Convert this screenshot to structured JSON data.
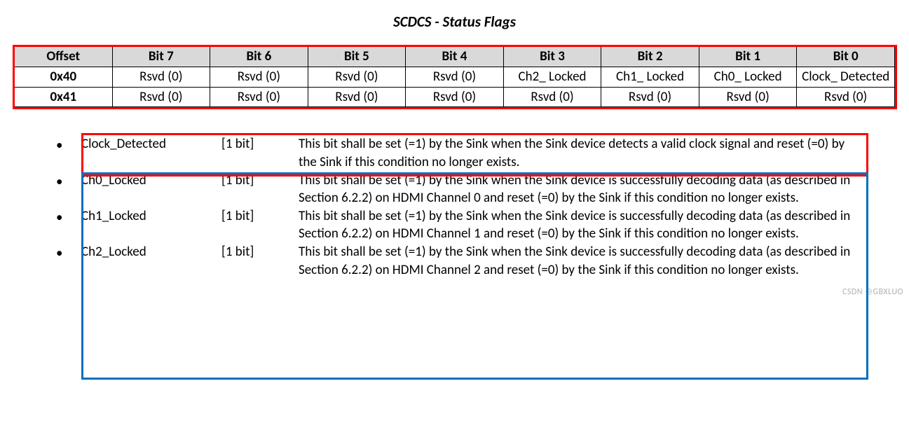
{
  "title": "SCDCS - Status Flags",
  "table": {
    "headers": [
      "Offset",
      "Bit 7",
      "Bit 6",
      "Bit 5",
      "Bit 4",
      "Bit 3",
      "Bit 2",
      "Bit 1",
      "Bit 0"
    ],
    "rows": [
      {
        "offset": "0x40",
        "bits": [
          "Rsvd (0)",
          "Rsvd (0)",
          "Rsvd (0)",
          "Rsvd (0)",
          "Ch2_\nLocked",
          "Ch1_\nLocked",
          "Ch0_\nLocked",
          "Clock_\nDetected"
        ]
      },
      {
        "offset": "0x41",
        "bits": [
          "Rsvd (0)",
          "Rsvd (0)",
          "Rsvd (0)",
          "Rsvd (0)",
          "Rsvd (0)",
          "Rsvd (0)",
          "Rsvd (0)",
          "Rsvd (0)"
        ]
      }
    ]
  },
  "fields": [
    {
      "name": "Clock_Detected",
      "size": "[1 bit]",
      "desc": "This bit shall be set (=1) by the Sink when the Sink device detects a valid clock signal and reset (=0) by the Sink if this condition no longer exists."
    },
    {
      "name": "Ch0_Locked",
      "size": "[1 bit]",
      "desc": "This bit shall be set (=1) by the Sink when the Sink device is successfully decoding data (as described in Section 6.2.2) on HDMI Channel 0 and reset (=0) by the Sink if this condition no longer exists."
    },
    {
      "name": "Ch1_Locked",
      "size": "[1 bit]",
      "desc": "This bit shall be set (=1) by the Sink when the Sink device is successfully decoding data (as described in Section 6.2.2) on HDMI Channel 1 and reset (=0) by the Sink if this condition no longer exists."
    },
    {
      "name": "Ch2_Locked",
      "size": "[1 bit]",
      "desc": "This bit shall be set (=1) by the Sink when the Sink device is successfully decoding data (as described in Section 6.2.2) on HDMI Channel 2 and reset (=0) by the Sink if this condition no longer exists."
    }
  ],
  "watermark": "CSDN @GBXLUO"
}
